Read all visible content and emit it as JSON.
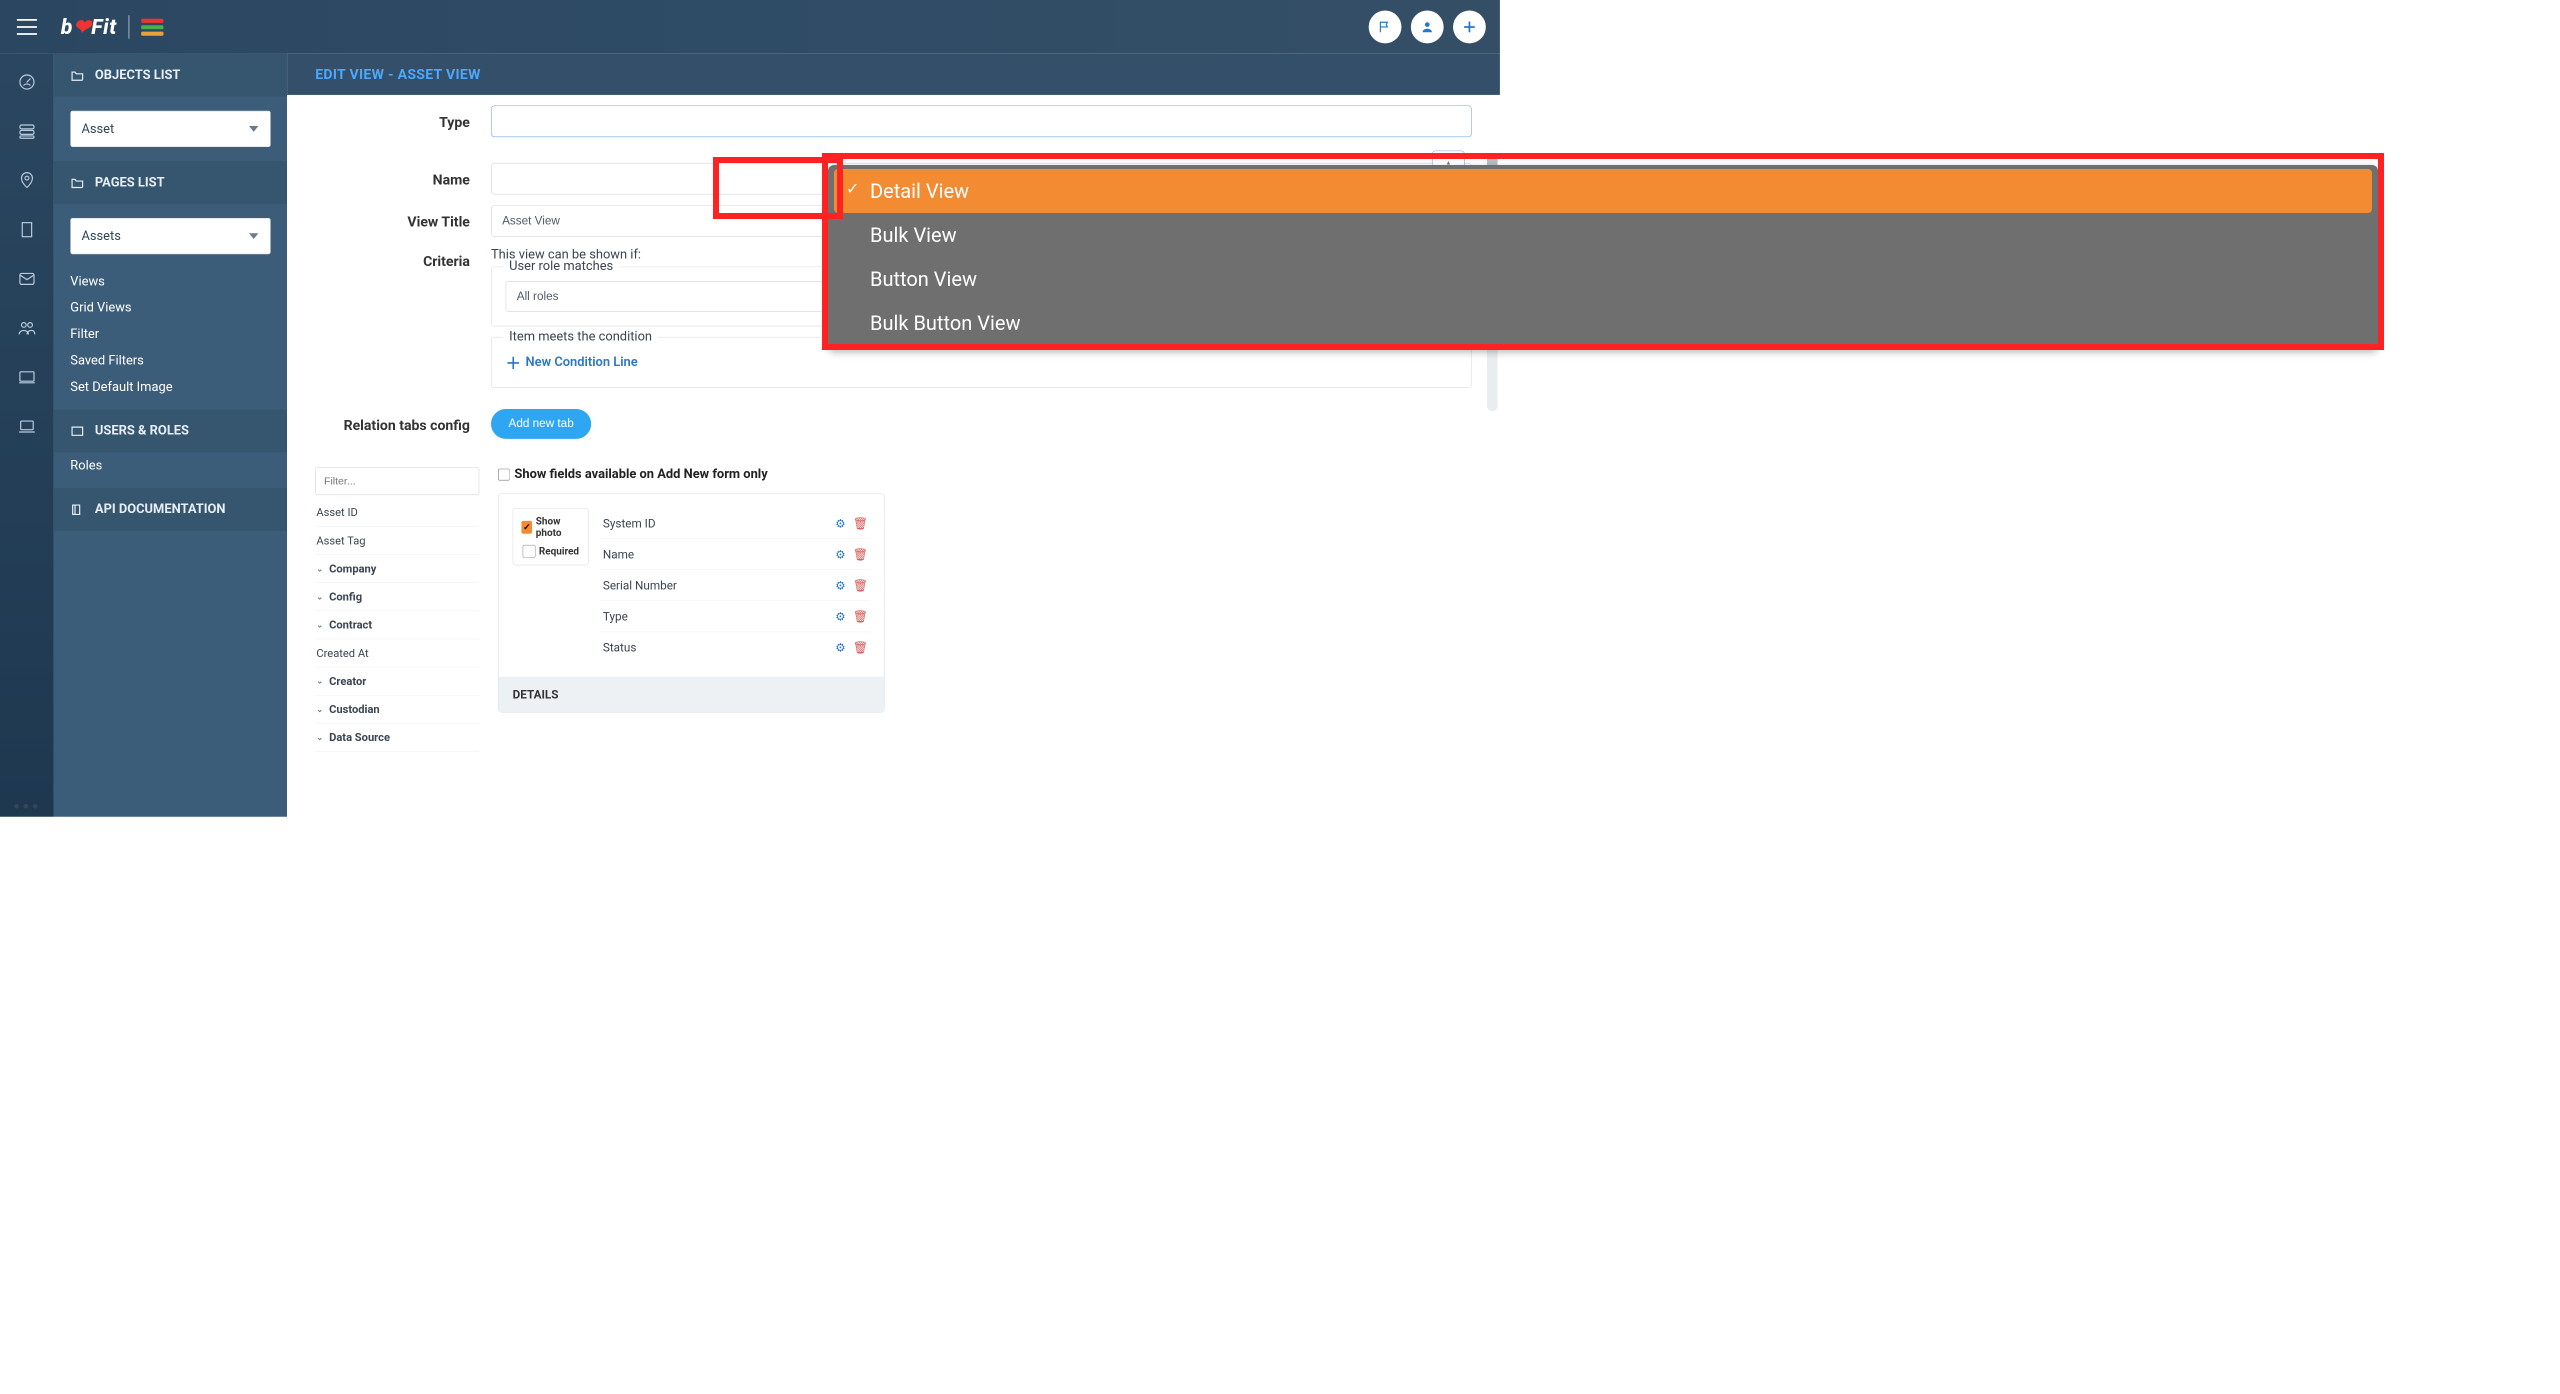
{
  "header": {
    "title": "EDIT VIEW - ASSET VIEW"
  },
  "sidebar": {
    "sections": {
      "objects": {
        "title": "OBJECTS LIST",
        "select_value": "Asset"
      },
      "pages": {
        "title": "PAGES LIST",
        "select_value": "Assets",
        "items": [
          "Views",
          "Grid Views",
          "Filter",
          "Saved Filters",
          "Set Default Image"
        ]
      },
      "users": {
        "title": "USERS & ROLES",
        "items": [
          "Roles"
        ]
      },
      "api": {
        "title": "API DOCUMENTATION"
      }
    }
  },
  "form": {
    "labels": {
      "type": "Type",
      "name": "Name",
      "view_title": "View Title",
      "criteria": "Criteria",
      "relation_tabs": "Relation tabs config"
    },
    "view_title_value": "Asset View",
    "criteria_intro": "This view can be shown if:",
    "user_role_legend": "User role matches",
    "roles_value": "All roles",
    "condition_legend": "Item meets the condition",
    "new_condition": "New Condition Line",
    "add_tab": "Add new tab",
    "show_fields_label": "Show fields available on Add New form only"
  },
  "type_dropdown": {
    "options": [
      "Detail View",
      "Bulk View",
      "Button View",
      "Bulk Button View"
    ],
    "selected": "Detail View"
  },
  "filter": {
    "placeholder": "Filter...",
    "fields": [
      {
        "label": "Asset ID",
        "expandable": false,
        "bold": false
      },
      {
        "label": "Asset Tag",
        "expandable": false,
        "bold": false
      },
      {
        "label": "Company",
        "expandable": true,
        "bold": true
      },
      {
        "label": "Config",
        "expandable": true,
        "bold": true
      },
      {
        "label": "Contract",
        "expandable": true,
        "bold": true
      },
      {
        "label": "Created At",
        "expandable": false,
        "bold": false
      },
      {
        "label": "Creator",
        "expandable": true,
        "bold": true
      },
      {
        "label": "Custodian",
        "expandable": true,
        "bold": true
      },
      {
        "label": "Data Source",
        "expandable": true,
        "bold": true
      }
    ]
  },
  "photo_box": {
    "show": "Show photo",
    "required": "Required"
  },
  "selected_fields": [
    "System ID",
    "Name",
    "Serial Number",
    "Type",
    "Status"
  ],
  "details_section": "DETAILS"
}
